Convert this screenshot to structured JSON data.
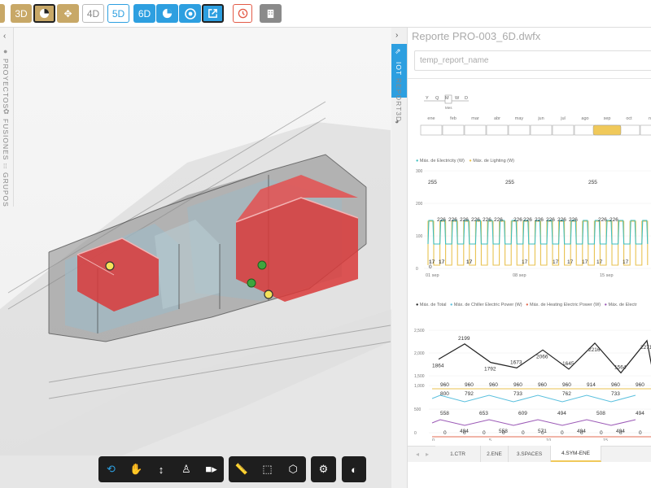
{
  "toolbar": {
    "btn_3d": "3D",
    "btn_4d": "4D",
    "btn_5d": "5D",
    "btn_6d": "6D"
  },
  "left_tabs": [
    "PROYECTOS",
    "FUSIONES",
    "GRUPOS"
  ],
  "right_tabs": {
    "iot": "IOT",
    "reportd": "REPORT3D"
  },
  "report": {
    "title": "Reporte PRO-003_6D.dwfx",
    "name_placeholder": "temp_report_name"
  },
  "timeline": {
    "granularity": [
      "Y",
      "Q",
      "M",
      "W",
      "D"
    ],
    "granularity_selected_label": "Mes",
    "months": [
      "ene",
      "feb",
      "mar",
      "abr",
      "may",
      "jun",
      "jul",
      "ago",
      "sep",
      "oct",
      "no"
    ]
  },
  "chart1": {
    "legend": [
      "Máx. de Electricity (W)",
      "Máx. de Lighting (W)"
    ],
    "colors": [
      "#3fbfbf",
      "#e8c250"
    ],
    "y_ticks": [
      "300",
      "200",
      "100",
      "0"
    ],
    "x_ticks": [
      "01 sep",
      "08 sep",
      "15 sep"
    ],
    "labels": [
      "255",
      "226",
      "226",
      "226",
      "226",
      "226",
      "226",
      "255",
      "226",
      "226",
      "226",
      "226",
      "226",
      "226",
      "255",
      "226",
      "226",
      "17",
      "17",
      "17",
      "0",
      "17",
      "17",
      "17",
      "17",
      "17",
      "17",
      "17",
      "17",
      "17"
    ]
  },
  "chart2": {
    "legend": [
      "Máx. de Total",
      "Máx. de Chiller Electric Power (W)",
      "Máx. de Heating Electric Power (W)",
      "Máx. de Electr"
    ],
    "colors": [
      "#222222",
      "#5bc0de",
      "#e36b52",
      "#9b59b6",
      "#e8c250"
    ],
    "y_ticks_top": [
      "2,500",
      "2,000",
      "1,500"
    ],
    "y_ticks_bottom": [
      "1,000",
      "500",
      "0"
    ],
    "x_ticks": [
      "0",
      "5",
      "10",
      "15"
    ],
    "total_values": [
      1864,
      2199,
      1792,
      1673,
      2066,
      1645,
      2216,
      1564,
      2271
    ],
    "chiller_labels": [
      "960",
      "960",
      "960",
      "960",
      "960",
      "960",
      "914",
      "960",
      "960"
    ],
    "mid_labels": [
      "800",
      "792",
      "733",
      "762",
      "733"
    ],
    "low_labels": [
      "558",
      "494",
      "653",
      "558",
      "609",
      "571",
      "494",
      "494",
      "508",
      "494",
      "494"
    ],
    "zero_labels": [
      "0",
      "0",
      "0",
      "0",
      "0",
      "0",
      "0",
      "0",
      "0",
      "0",
      "0"
    ]
  },
  "bottom_tabs": [
    "1.CTR",
    "2.ENE",
    "3.SPACES",
    "4.SYM-ENE"
  ],
  "bottom_tab_active": 3
}
